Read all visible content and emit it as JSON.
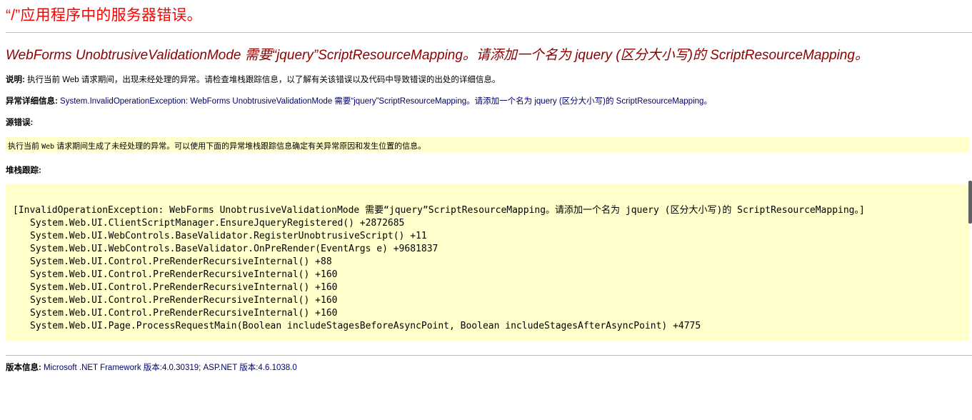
{
  "page": {
    "title": "“/”应用程序中的服务器错误。",
    "error_heading": "WebForms UnobtrusiveValidationMode 需要“jquery”ScriptResourceMapping。请添加一个名为 jquery (区分大小写)的 ScriptResourceMapping。"
  },
  "description": {
    "label": "说明:",
    "text": "执行当前 Web 请求期间，出现未经处理的异常。请检查堆栈跟踪信息，以了解有关该错误以及代码中导致错误的出处的详细信息。"
  },
  "exception_details": {
    "label": "异常详细信息:",
    "text": "System.InvalidOperationException: WebForms UnobtrusiveValidationMode 需要“jquery”ScriptResourceMapping。请添加一个名为 jquery (区分大小写)的 ScriptResourceMapping。"
  },
  "source_error": {
    "label": "源错误:",
    "text_prefix": "执行当前 ",
    "text_mono": "Web",
    "text_suffix": " 请求期间生成了未经处理的异常。可以使用下面的异常堆栈跟踪信息确定有关异常原因和发生位置的信息。"
  },
  "stack_trace": {
    "label": "堆栈跟踪:",
    "header": "[InvalidOperationException: WebForms UnobtrusiveValidationMode 需要“jquery”ScriptResourceMapping。请添加一个名为 jquery (区分大小写)的 ScriptResourceMapping。]",
    "frames": [
      "System.Web.UI.ClientScriptManager.EnsureJqueryRegistered() +2872685",
      "System.Web.UI.WebControls.BaseValidator.RegisterUnobtrusiveScript() +11",
      "System.Web.UI.WebControls.BaseValidator.OnPreRender(EventArgs e) +9681837",
      "System.Web.UI.Control.PreRenderRecursiveInternal() +88",
      "System.Web.UI.Control.PreRenderRecursiveInternal() +160",
      "System.Web.UI.Control.PreRenderRecursiveInternal() +160",
      "System.Web.UI.Control.PreRenderRecursiveInternal() +160",
      "System.Web.UI.Control.PreRenderRecursiveInternal() +160",
      "System.Web.UI.Page.ProcessRequestMain(Boolean includeStagesBeforeAsyncPoint, Boolean includeStagesAfterAsyncPoint) +4775"
    ]
  },
  "version_info": {
    "label": "版本信息:",
    "text": "Microsoft .NET Framework 版本:4.0.30319; ASP.NET 版本:4.6.1038.0"
  },
  "colors": {
    "title": "#ff0000",
    "error_heading": "#8b0000",
    "code_background": "#ffffcc",
    "rule": "#c0c0c0"
  }
}
